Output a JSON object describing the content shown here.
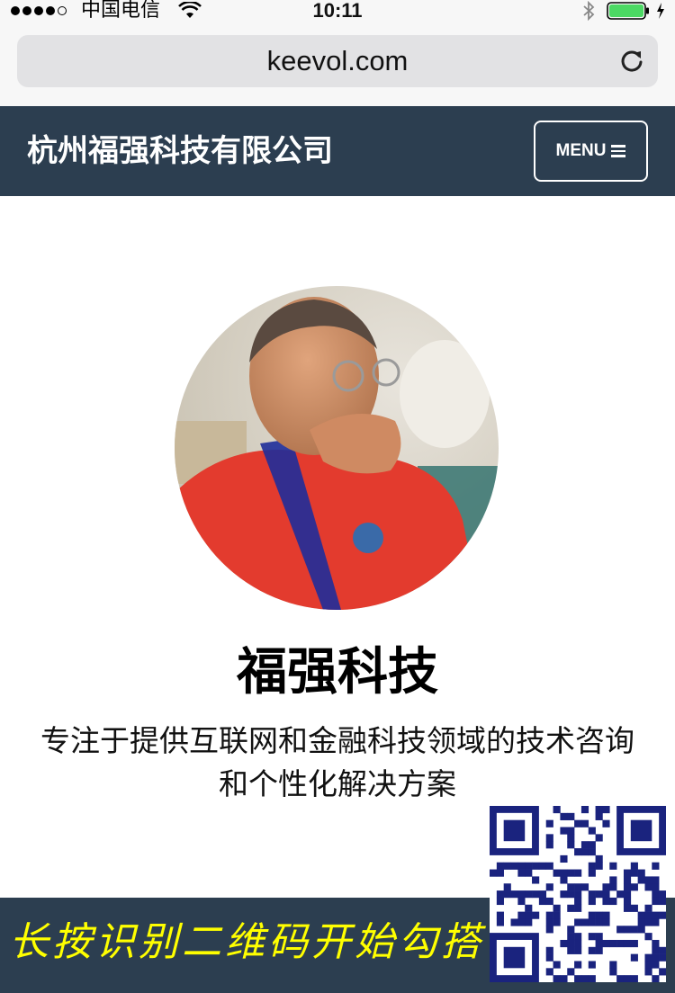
{
  "status_bar": {
    "carrier": "中国电信",
    "time": "10:11",
    "signal_icon": "signal-dots-icon",
    "wifi_icon": "wifi-icon",
    "bluetooth_icon": "bluetooth-icon",
    "battery_icon": "battery-icon",
    "battery_color": "#4cd964"
  },
  "browser": {
    "url": "keevol.com",
    "reload_icon": "reload-icon"
  },
  "nav": {
    "brand": "杭州福强科技有限公司",
    "menu_label": "MENU",
    "menu_icon": "hamburger-icon",
    "background": "#2c3e50"
  },
  "hero": {
    "avatar": "profile-photo",
    "title": "福强科技",
    "description": "专注于提供互联网和金融科技领域的技术咨询和个性化解决方案"
  },
  "footer": {
    "text": "长按识别二维码开始勾搭",
    "text_color": "#ffff00",
    "qr_icon": "qr-code-icon",
    "qr_color": "#1a237e"
  }
}
